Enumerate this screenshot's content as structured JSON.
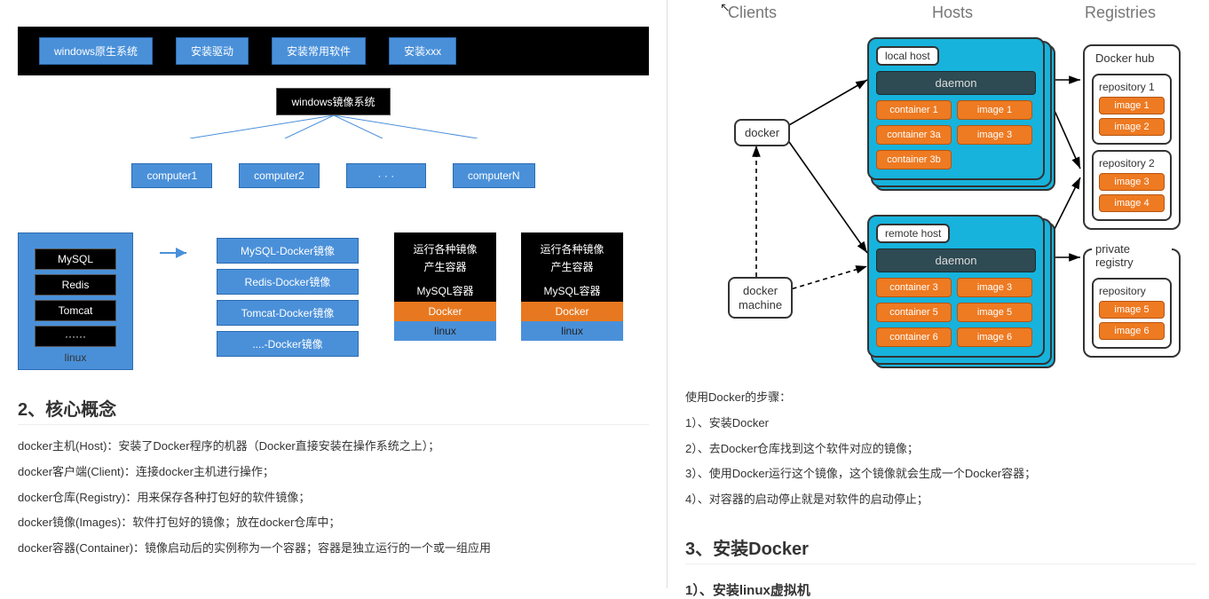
{
  "diagram1": {
    "top_bar": [
      "windows原生系统",
      "安装驱动",
      "安装常用软件",
      "安装xxx"
    ],
    "mirror": "windows镜像系统",
    "computers": [
      "computer1",
      "computer2",
      "· · ·",
      "computerN"
    ]
  },
  "diagram2": {
    "linux_items": [
      "MySQL",
      "Redis",
      "Tomcat",
      "······"
    ],
    "linux_label": "linux",
    "images": [
      "MySQL-Docker镜像",
      "Redis-Docker镜像",
      "Tomcat-Docker镜像",
      "....-Docker镜像"
    ],
    "stack": {
      "line1": "运行各种镜像",
      "line2": "产生容器",
      "line3": "MySQL容器",
      "docker": "Docker",
      "linux": "linux"
    }
  },
  "section2_heading": "2、核心概念",
  "concepts": [
    "docker主机(Host)：安装了Docker程序的机器（Docker直接安装在操作系统之上）；",
    "docker客户端(Client)：连接docker主机进行操作；",
    "docker仓库(Registry)：用来保存各种打包好的软件镜像；",
    "docker镜像(Images)：软件打包好的镜像；放在docker仓库中；",
    "docker容器(Container)：镜像启动后的实例称为一个容器；容器是独立运行的一个或一组应用"
  ],
  "arch": {
    "cols": {
      "clients": "Clients",
      "hosts": "Hosts",
      "registries": "Registries"
    },
    "client1": "docker",
    "client2_l1": "docker",
    "client2_l2": "machine",
    "host1": {
      "label": "local host",
      "daemon": "daemon",
      "cells": [
        "container 1",
        "image 1",
        "container 3a",
        "image 3",
        "container 3b"
      ]
    },
    "host2": {
      "label": "remote host",
      "daemon": "daemon",
      "cells": [
        "container 3",
        "image 3",
        "container 5",
        "image 5",
        "container 6",
        "image 6"
      ]
    },
    "reg1": {
      "title": "Docker hub",
      "repo1": {
        "title": "repository 1",
        "items": [
          "image 1",
          "image 2"
        ]
      },
      "repo2": {
        "title": "repository 2",
        "items": [
          "image 3",
          "image 4"
        ]
      }
    },
    "reg2": {
      "title": "private registry",
      "repo1": {
        "title": "repository",
        "items": [
          "image 5",
          "image 6"
        ]
      }
    }
  },
  "steps_intro": "使用Docker的步骤：",
  "steps": [
    "1）、安装Docker",
    "2）、去Docker仓库找到这个软件对应的镜像；",
    "3）、使用Docker运行这个镜像，这个镜像就会生成一个Docker容器；",
    "4）、对容器的启动停止就是对软件的启动停止；"
  ],
  "section3_heading": "3、安装Docker",
  "section3_sub": "1）、安装linux虚拟机"
}
